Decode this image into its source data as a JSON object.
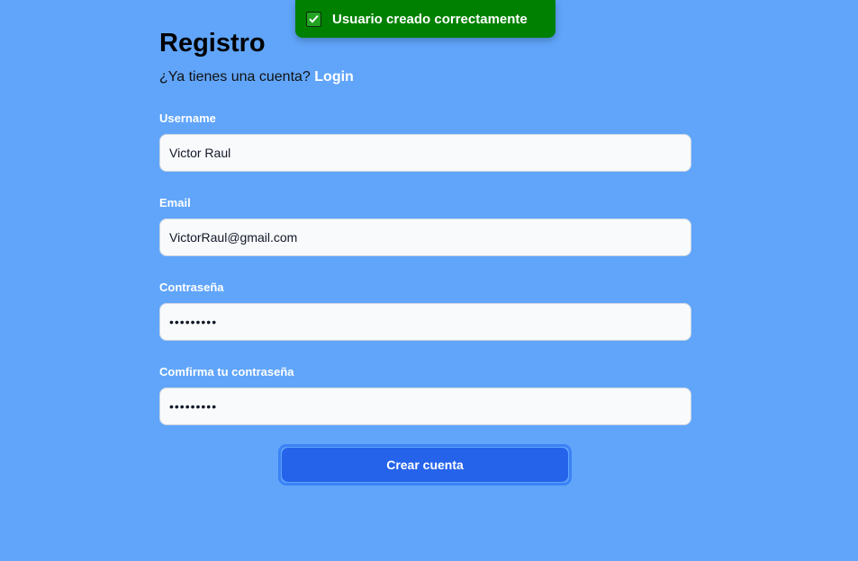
{
  "toast": {
    "message": "Usuario creado correctamente",
    "icon": "check-icon"
  },
  "page": {
    "title": "Registro",
    "subtitle_prompt": "¿Ya tienes una cuenta?",
    "login_link": "Login"
  },
  "form": {
    "username": {
      "label": "Username",
      "value": "Victor Raul"
    },
    "email": {
      "label": "Email",
      "value": "VictorRaul@gmail.com"
    },
    "password": {
      "label": "Contraseña",
      "value": "•••••••••"
    },
    "confirm_password": {
      "label": "Comfirma tu contraseña",
      "value": "•••••••••"
    },
    "submit_label": "Crear cuenta"
  },
  "colors": {
    "background": "#60a5fa",
    "toast": "#008000",
    "button": "#2563eb"
  }
}
